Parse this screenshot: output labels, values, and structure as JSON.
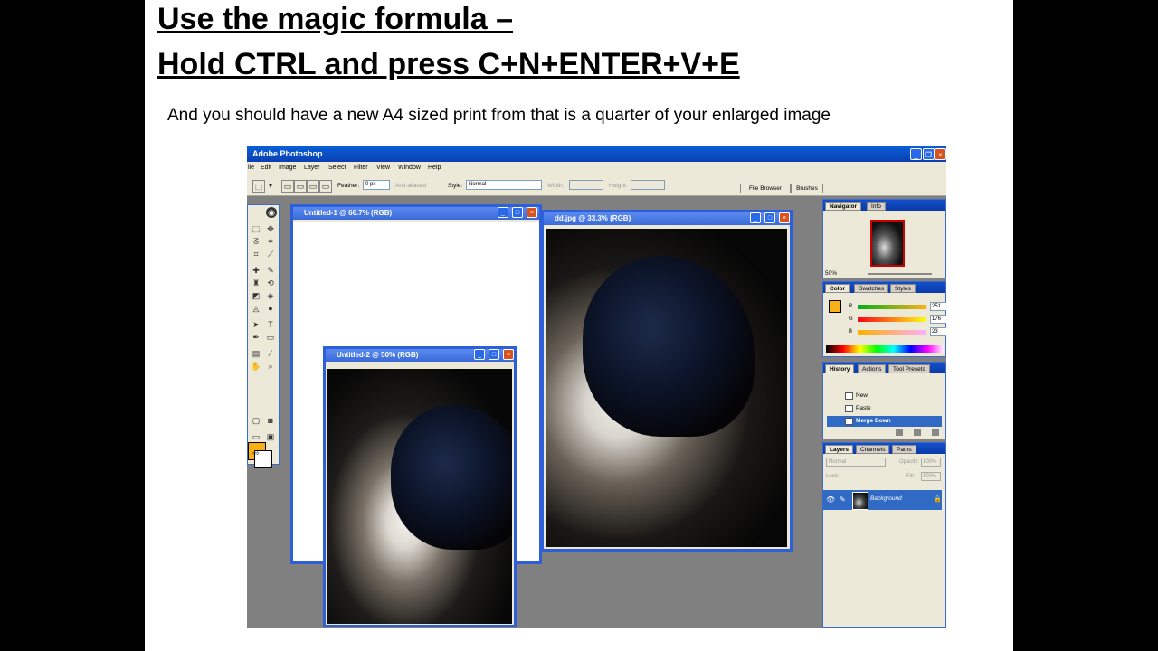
{
  "slide": {
    "title_line1": "Use the magic formula –",
    "title_line2": "Hold CTRL and press C+N+ENTER+V+E",
    "subtitle": "And you should have a new A4 sized print from that is a quarter of your enlarged image"
  },
  "app": {
    "title": "Adobe Photoshop",
    "menu": [
      "ile",
      "Edit",
      "Image",
      "Layer",
      "Select",
      "Filter",
      "View",
      "Window",
      "Help"
    ],
    "options": {
      "feather_label": "Feather:",
      "feather_value": "0 px",
      "anti_aliased": "Anti-aliased",
      "style_label": "Style:",
      "style_value": "Normal",
      "width_label": "Width:",
      "height_label": "Height:",
      "file_browser": "File Browser",
      "brushes": "Brushes"
    },
    "documents": {
      "untitled1": "Untitled-1 @ 66.7% (RGB)",
      "untitled2": "Untitled-2 @ 50% (RGB)",
      "ddjpg": "dd.jpg @ 33.3% (RGB)"
    },
    "foreground_color": "#f8b014",
    "navigator": {
      "tabs": [
        "Navigator",
        "Info"
      ],
      "zoom": "50%"
    },
    "color_panel": {
      "tabs": [
        "Color",
        "Swatches",
        "Styles"
      ],
      "channels": [
        {
          "label": "R",
          "value": "251"
        },
        {
          "label": "G",
          "value": "176"
        },
        {
          "label": "B",
          "value": "23"
        }
      ]
    },
    "history": {
      "tabs": [
        "History",
        "Actions",
        "Tool Presets"
      ],
      "items": [
        "New",
        "Paste",
        "Merge Down"
      ]
    },
    "layers": {
      "tabs": [
        "Layers",
        "Channels",
        "Paths"
      ],
      "blend_mode": "Normal",
      "opacity_label": "Opacity:",
      "opacity_value": "100%",
      "lock_label": "Lock:",
      "fill_label": "Fill:",
      "fill_value": "100%",
      "layer_name": "Background"
    }
  }
}
